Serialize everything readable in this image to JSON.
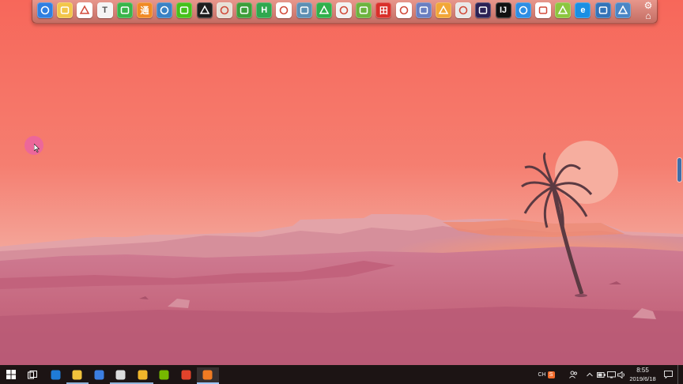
{
  "desktop": {
    "wallpaper": {
      "sky_top": "#f7685a",
      "sky_bottom": "#f3a69b",
      "sun": "#f6ab9d",
      "mountains": "#d8909a",
      "sand": "#c96b86",
      "foreground_sand": "#c0607c",
      "palm": "#5a3840"
    }
  },
  "dock": {
    "icons": [
      {
        "name": "security-shield-icon",
        "bg": "#2f7fe0",
        "glyph": ""
      },
      {
        "name": "folder-icon",
        "bg": "#f2c64a",
        "glyph": ""
      },
      {
        "name": "chrome-icon",
        "bg": "#ffffff",
        "glyph": ""
      },
      {
        "name": "text-editor-icon",
        "bg": "#f4f4f4",
        "glyph": "T"
      },
      {
        "name": "eye-care-icon",
        "bg": "#39b54a",
        "glyph": ""
      },
      {
        "name": "app-orange-icon",
        "bg": "#f08a24",
        "glyph": "通"
      },
      {
        "name": "monitor-icon",
        "bg": "#3a82c4",
        "glyph": ""
      },
      {
        "name": "wechat-icon",
        "bg": "#46c01b",
        "glyph": ""
      },
      {
        "name": "qq-penguin-icon",
        "bg": "#1e1e1e",
        "glyph": ""
      },
      {
        "name": "java-coffee-icon",
        "bg": "#e7e0d6",
        "glyph": ""
      },
      {
        "name": "leaf-app-icon",
        "bg": "#3d9e3a",
        "glyph": ""
      },
      {
        "name": "hbuilder-icon",
        "bg": "#2fa84f",
        "glyph": "H"
      },
      {
        "name": "aperture-icon",
        "bg": "#ffffff",
        "glyph": ""
      },
      {
        "name": "photo-viewer-icon",
        "bg": "#5d8fb3",
        "glyph": ""
      },
      {
        "name": "security-app-icon",
        "bg": "#2fb04b",
        "glyph": ""
      },
      {
        "name": "chat-bubble-icon",
        "bg": "#f2f2f2",
        "glyph": ""
      },
      {
        "name": "spring-leaf-icon",
        "bg": "#6db33f",
        "glyph": ""
      },
      {
        "name": "red-app-icon",
        "bg": "#d9302a",
        "glyph": "田"
      },
      {
        "name": "dev-tool-icon",
        "bg": "#ffffff",
        "glyph": ""
      },
      {
        "name": "document-icon",
        "bg": "#6a7fc1",
        "glyph": ""
      },
      {
        "name": "notebook-icon",
        "bg": "#f2a637",
        "glyph": ""
      },
      {
        "name": "gallery-icon",
        "bg": "#e8e8e8",
        "glyph": ""
      },
      {
        "name": "eclipse-icon",
        "bg": "#2c2255",
        "glyph": ""
      },
      {
        "name": "intellij-icon",
        "bg": "#111111",
        "glyph": "IJ"
      },
      {
        "name": "bird-app-icon",
        "bg": "#2d8ee3",
        "glyph": ""
      },
      {
        "name": "cloud-app-icon",
        "bg": "#ffffff",
        "glyph": ""
      },
      {
        "name": "map-icon",
        "bg": "#8cc63f",
        "glyph": ""
      },
      {
        "name": "internet-explorer-icon",
        "bg": "#1a8fe3",
        "glyph": "e"
      },
      {
        "name": "computer-icon",
        "bg": "#3474b8",
        "glyph": ""
      },
      {
        "name": "picture-edit-icon",
        "bg": "#4a86c5",
        "glyph": ""
      }
    ],
    "settings_glyph": "⚙",
    "home_glyph": "⌂"
  },
  "taskbar": {
    "apps": [
      {
        "name": "taskbar-edge-icon",
        "state": "normal"
      },
      {
        "name": "taskbar-file-explorer-icon",
        "state": "open"
      },
      {
        "name": "taskbar-wps-icon",
        "state": "normal"
      },
      {
        "name": "taskbar-app-icon",
        "state": "open"
      },
      {
        "name": "taskbar-vm-icon",
        "state": "open"
      },
      {
        "name": "taskbar-nvidia-icon",
        "state": "normal"
      },
      {
        "name": "taskbar-weibo-icon",
        "state": "normal"
      },
      {
        "name": "taskbar-orange-app-icon",
        "state": "active"
      }
    ],
    "tray": {
      "ime_label": "CH",
      "ime_glyph": "S"
    },
    "clock": {
      "time": "8:55",
      "date": "2019/6/18"
    }
  },
  "colors": {
    "taskbar_bg": "#1c1414",
    "dock_bg": "#d9877c",
    "cursor_halo": "#e860aa",
    "edge_handle": "#3f6fa9"
  }
}
